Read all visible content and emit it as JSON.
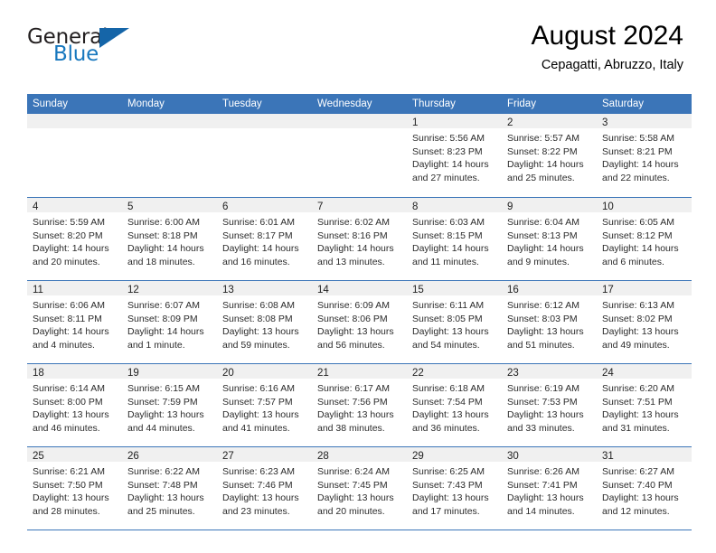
{
  "logo": {
    "word_one": "General",
    "word_two": "Blue",
    "triangle_color": "#1565a8",
    "blue_color": "#1878be",
    "dark_color": "#231f20"
  },
  "header": {
    "title": "August 2024",
    "subtitle": "Cepagatti, Abruzzo, Italy"
  },
  "theme": {
    "header_blue": "#3b75b8",
    "datebar_gray": "#f0f0f0"
  },
  "weekdays": [
    "Sunday",
    "Monday",
    "Tuesday",
    "Wednesday",
    "Thursday",
    "Friday",
    "Saturday"
  ],
  "weeks": [
    [
      {
        "day": "",
        "sunrise": "",
        "sunset": "",
        "daylight_1": "",
        "daylight_2": "",
        "empty": true
      },
      {
        "day": "",
        "sunrise": "",
        "sunset": "",
        "daylight_1": "",
        "daylight_2": "",
        "empty": true
      },
      {
        "day": "",
        "sunrise": "",
        "sunset": "",
        "daylight_1": "",
        "daylight_2": "",
        "empty": true
      },
      {
        "day": "",
        "sunrise": "",
        "sunset": "",
        "daylight_1": "",
        "daylight_2": "",
        "empty": true
      },
      {
        "day": "1",
        "sunrise": "Sunrise: 5:56 AM",
        "sunset": "Sunset: 8:23 PM",
        "daylight_1": "Daylight: 14 hours",
        "daylight_2": "and 27 minutes."
      },
      {
        "day": "2",
        "sunrise": "Sunrise: 5:57 AM",
        "sunset": "Sunset: 8:22 PM",
        "daylight_1": "Daylight: 14 hours",
        "daylight_2": "and 25 minutes."
      },
      {
        "day": "3",
        "sunrise": "Sunrise: 5:58 AM",
        "sunset": "Sunset: 8:21 PM",
        "daylight_1": "Daylight: 14 hours",
        "daylight_2": "and 22 minutes."
      }
    ],
    [
      {
        "day": "4",
        "sunrise": "Sunrise: 5:59 AM",
        "sunset": "Sunset: 8:20 PM",
        "daylight_1": "Daylight: 14 hours",
        "daylight_2": "and 20 minutes."
      },
      {
        "day": "5",
        "sunrise": "Sunrise: 6:00 AM",
        "sunset": "Sunset: 8:18 PM",
        "daylight_1": "Daylight: 14 hours",
        "daylight_2": "and 18 minutes."
      },
      {
        "day": "6",
        "sunrise": "Sunrise: 6:01 AM",
        "sunset": "Sunset: 8:17 PM",
        "daylight_1": "Daylight: 14 hours",
        "daylight_2": "and 16 minutes."
      },
      {
        "day": "7",
        "sunrise": "Sunrise: 6:02 AM",
        "sunset": "Sunset: 8:16 PM",
        "daylight_1": "Daylight: 14 hours",
        "daylight_2": "and 13 minutes."
      },
      {
        "day": "8",
        "sunrise": "Sunrise: 6:03 AM",
        "sunset": "Sunset: 8:15 PM",
        "daylight_1": "Daylight: 14 hours",
        "daylight_2": "and 11 minutes."
      },
      {
        "day": "9",
        "sunrise": "Sunrise: 6:04 AM",
        "sunset": "Sunset: 8:13 PM",
        "daylight_1": "Daylight: 14 hours",
        "daylight_2": "and 9 minutes."
      },
      {
        "day": "10",
        "sunrise": "Sunrise: 6:05 AM",
        "sunset": "Sunset: 8:12 PM",
        "daylight_1": "Daylight: 14 hours",
        "daylight_2": "and 6 minutes."
      }
    ],
    [
      {
        "day": "11",
        "sunrise": "Sunrise: 6:06 AM",
        "sunset": "Sunset: 8:11 PM",
        "daylight_1": "Daylight: 14 hours",
        "daylight_2": "and 4 minutes."
      },
      {
        "day": "12",
        "sunrise": "Sunrise: 6:07 AM",
        "sunset": "Sunset: 8:09 PM",
        "daylight_1": "Daylight: 14 hours",
        "daylight_2": "and 1 minute."
      },
      {
        "day": "13",
        "sunrise": "Sunrise: 6:08 AM",
        "sunset": "Sunset: 8:08 PM",
        "daylight_1": "Daylight: 13 hours",
        "daylight_2": "and 59 minutes."
      },
      {
        "day": "14",
        "sunrise": "Sunrise: 6:09 AM",
        "sunset": "Sunset: 8:06 PM",
        "daylight_1": "Daylight: 13 hours",
        "daylight_2": "and 56 minutes."
      },
      {
        "day": "15",
        "sunrise": "Sunrise: 6:11 AM",
        "sunset": "Sunset: 8:05 PM",
        "daylight_1": "Daylight: 13 hours",
        "daylight_2": "and 54 minutes."
      },
      {
        "day": "16",
        "sunrise": "Sunrise: 6:12 AM",
        "sunset": "Sunset: 8:03 PM",
        "daylight_1": "Daylight: 13 hours",
        "daylight_2": "and 51 minutes."
      },
      {
        "day": "17",
        "sunrise": "Sunrise: 6:13 AM",
        "sunset": "Sunset: 8:02 PM",
        "daylight_1": "Daylight: 13 hours",
        "daylight_2": "and 49 minutes."
      }
    ],
    [
      {
        "day": "18",
        "sunrise": "Sunrise: 6:14 AM",
        "sunset": "Sunset: 8:00 PM",
        "daylight_1": "Daylight: 13 hours",
        "daylight_2": "and 46 minutes."
      },
      {
        "day": "19",
        "sunrise": "Sunrise: 6:15 AM",
        "sunset": "Sunset: 7:59 PM",
        "daylight_1": "Daylight: 13 hours",
        "daylight_2": "and 44 minutes."
      },
      {
        "day": "20",
        "sunrise": "Sunrise: 6:16 AM",
        "sunset": "Sunset: 7:57 PM",
        "daylight_1": "Daylight: 13 hours",
        "daylight_2": "and 41 minutes."
      },
      {
        "day": "21",
        "sunrise": "Sunrise: 6:17 AM",
        "sunset": "Sunset: 7:56 PM",
        "daylight_1": "Daylight: 13 hours",
        "daylight_2": "and 38 minutes."
      },
      {
        "day": "22",
        "sunrise": "Sunrise: 6:18 AM",
        "sunset": "Sunset: 7:54 PM",
        "daylight_1": "Daylight: 13 hours",
        "daylight_2": "and 36 minutes."
      },
      {
        "day": "23",
        "sunrise": "Sunrise: 6:19 AM",
        "sunset": "Sunset: 7:53 PM",
        "daylight_1": "Daylight: 13 hours",
        "daylight_2": "and 33 minutes."
      },
      {
        "day": "24",
        "sunrise": "Sunrise: 6:20 AM",
        "sunset": "Sunset: 7:51 PM",
        "daylight_1": "Daylight: 13 hours",
        "daylight_2": "and 31 minutes."
      }
    ],
    [
      {
        "day": "25",
        "sunrise": "Sunrise: 6:21 AM",
        "sunset": "Sunset: 7:50 PM",
        "daylight_1": "Daylight: 13 hours",
        "daylight_2": "and 28 minutes."
      },
      {
        "day": "26",
        "sunrise": "Sunrise: 6:22 AM",
        "sunset": "Sunset: 7:48 PM",
        "daylight_1": "Daylight: 13 hours",
        "daylight_2": "and 25 minutes."
      },
      {
        "day": "27",
        "sunrise": "Sunrise: 6:23 AM",
        "sunset": "Sunset: 7:46 PM",
        "daylight_1": "Daylight: 13 hours",
        "daylight_2": "and 23 minutes."
      },
      {
        "day": "28",
        "sunrise": "Sunrise: 6:24 AM",
        "sunset": "Sunset: 7:45 PM",
        "daylight_1": "Daylight: 13 hours",
        "daylight_2": "and 20 minutes."
      },
      {
        "day": "29",
        "sunrise": "Sunrise: 6:25 AM",
        "sunset": "Sunset: 7:43 PM",
        "daylight_1": "Daylight: 13 hours",
        "daylight_2": "and 17 minutes."
      },
      {
        "day": "30",
        "sunrise": "Sunrise: 6:26 AM",
        "sunset": "Sunset: 7:41 PM",
        "daylight_1": "Daylight: 13 hours",
        "daylight_2": "and 14 minutes."
      },
      {
        "day": "31",
        "sunrise": "Sunrise: 6:27 AM",
        "sunset": "Sunset: 7:40 PM",
        "daylight_1": "Daylight: 13 hours",
        "daylight_2": "and 12 minutes."
      }
    ]
  ]
}
